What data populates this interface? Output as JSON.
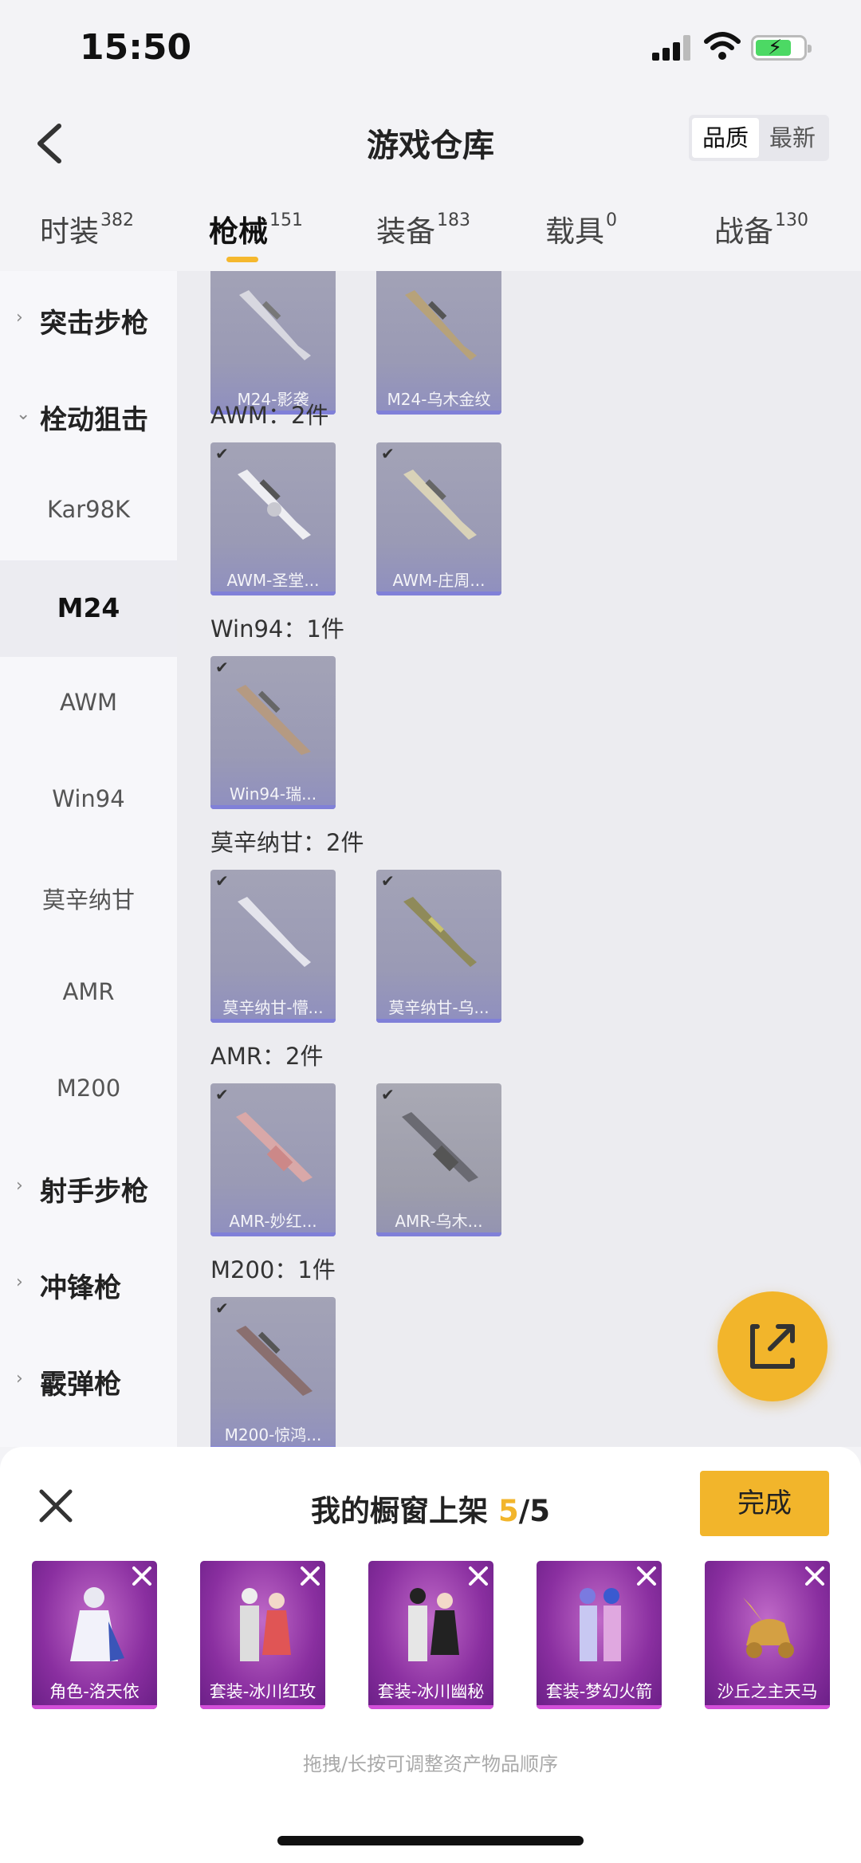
{
  "status_bar": {
    "time": "15:50"
  },
  "header": {
    "title": "游戏仓库",
    "sort_options": [
      "品质",
      "最新"
    ],
    "sort_selected": "品质"
  },
  "tabs": [
    {
      "label": "时装",
      "count": "382"
    },
    {
      "label": "枪械",
      "count": "151",
      "active": true
    },
    {
      "label": "装备",
      "count": "183"
    },
    {
      "label": "载具",
      "count": "0"
    },
    {
      "label": "战备",
      "count": "130"
    }
  ],
  "sidebar": {
    "items": [
      {
        "label": "突击步枪",
        "type": "parent",
        "expanded": false
      },
      {
        "label": "栓动狙击",
        "type": "parent",
        "expanded": true
      },
      {
        "label": "Kar98K",
        "type": "sub"
      },
      {
        "label": "M24",
        "type": "sub",
        "selected": true
      },
      {
        "label": "AWM",
        "type": "sub"
      },
      {
        "label": "Win94",
        "type": "sub"
      },
      {
        "label": "莫辛纳甘",
        "type": "sub"
      },
      {
        "label": "AMR",
        "type": "sub"
      },
      {
        "label": "M200",
        "type": "sub"
      },
      {
        "label": "射手步枪",
        "type": "parent",
        "expanded": false
      },
      {
        "label": "冲锋枪",
        "type": "parent",
        "expanded": false
      },
      {
        "label": "霰弹枪",
        "type": "parent",
        "expanded": false
      }
    ]
  },
  "content": {
    "partial_items": [
      {
        "name": "M24-影袭"
      },
      {
        "name": "M24-乌木金纹"
      }
    ],
    "sections": [
      {
        "title": "AWM：2件",
        "items": [
          {
            "name": "AWM-圣堂..."
          },
          {
            "name": "AWM-庄周..."
          }
        ]
      },
      {
        "title": "Win94：1件",
        "items": [
          {
            "name": "Win94-瑞..."
          }
        ]
      },
      {
        "title": "莫辛纳甘：2件",
        "items": [
          {
            "name": "莫辛纳甘-懵..."
          },
          {
            "name": "莫辛纳甘-乌..."
          }
        ]
      },
      {
        "title": "AMR：2件",
        "items": [
          {
            "name": "AMR-妙红..."
          },
          {
            "name": "AMR-乌木..."
          }
        ]
      },
      {
        "title": "M200：1件",
        "items": [
          {
            "name": "M200-惊鸿..."
          }
        ]
      }
    ]
  },
  "showcase": {
    "title_prefix": "我的橱窗上架 ",
    "count": "5",
    "total": "/5",
    "done_label": "完成",
    "items": [
      {
        "name": "角色-洛天依"
      },
      {
        "name": "套装-冰川红玫"
      },
      {
        "name": "套装-冰川幽秘"
      },
      {
        "name": "套装-梦幻火箭"
      },
      {
        "name": "沙丘之主天马"
      }
    ],
    "hint": "拖拽/长按可调整资产物品顺序"
  },
  "colors": {
    "accent": "#f2b52b",
    "card_bar": "#8080d8",
    "showcase_bg": "#8a2fa0"
  }
}
